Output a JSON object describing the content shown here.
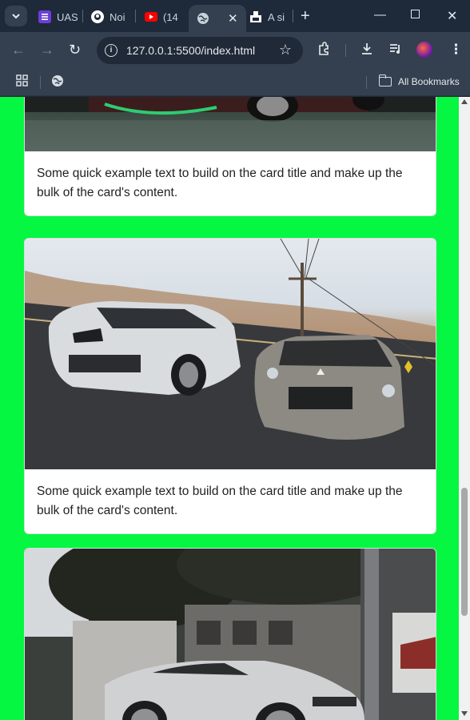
{
  "browser": {
    "tabs": [
      {
        "label": "UAS",
        "favicon": "purple-form-icon",
        "color": "#6b3fd6"
      },
      {
        "label": "Noi",
        "favicon": "github-icon",
        "color": "#ffffff"
      },
      {
        "label": "(14",
        "favicon": "youtube-icon",
        "color": "#ff0000"
      },
      {
        "label": "",
        "favicon": "globe-icon",
        "color": "#c9d1da"
      },
      {
        "label": "A si",
        "favicon": "app-icon",
        "color": "#ffffff"
      }
    ],
    "address": "127.0.0.1:5500/index.html",
    "bookmarks_label": "All Bookmarks"
  },
  "page": {
    "background": "#06f741",
    "cards": [
      {
        "text": "Some quick example text to build on the card title and make up the bulk of the card's content."
      },
      {
        "text": "Some quick example text to build on the card title and make up the bulk of the card's content."
      },
      {
        "text": ""
      }
    ]
  }
}
